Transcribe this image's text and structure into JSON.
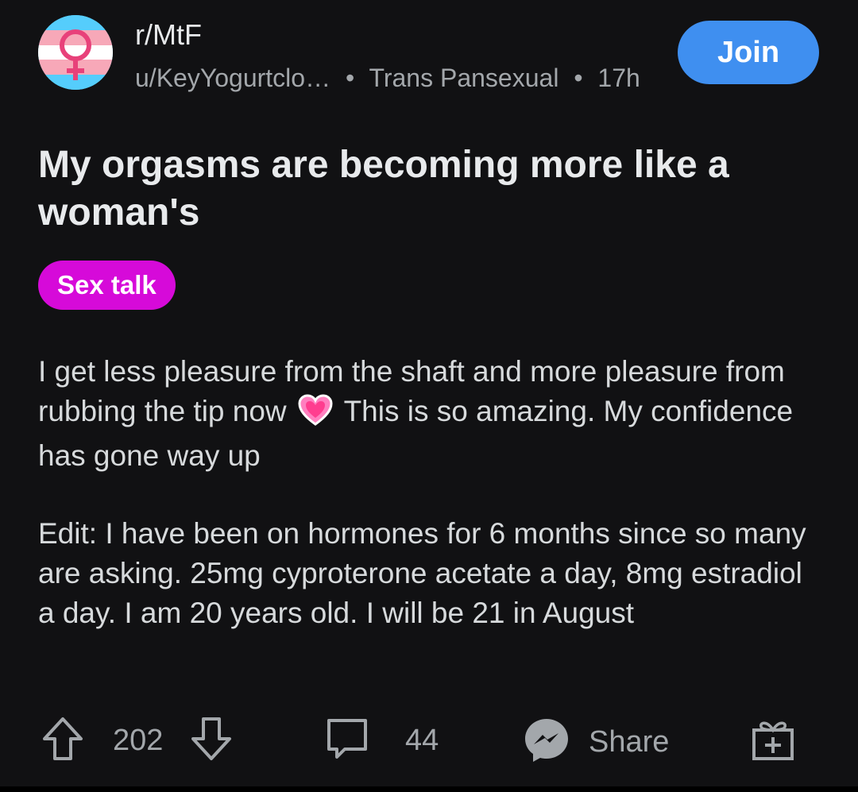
{
  "post": {
    "subreddit": "r/MtF",
    "author": "u/KeyYogurtclo…",
    "user_flair": "Trans Pansexual",
    "age": "17h",
    "join_label": "Join",
    "title": "My orgasms are becoming more like a woman's",
    "flair": "Sex talk",
    "body_p1_a": "I get less pleasure from the shaft and more pleasure from rubbing the tip now",
    "body_p1_b": "This is so amazing. My confidence has gone way up",
    "body_p2": "Edit: I have been on hormones for 6 months since so many are asking. 25mg cyproterone acetate a day, 8mg estradiol a day. I am 20 years old. I will be 21 in August"
  },
  "actions": {
    "upvotes": "202",
    "comments": "44",
    "share_label": "Share"
  },
  "icons": {
    "avatar": "trans-flag-venus-icon",
    "upvote": "upvote-arrow-icon",
    "downvote": "downvote-arrow-icon",
    "comment": "comment-bubble-icon",
    "share": "messenger-icon",
    "award": "gift-icon",
    "emoji": "heart-emoji-icon"
  },
  "colors": {
    "background": "#111113",
    "join_button": "#3f8ff0",
    "flair": "#d60ad9",
    "text": "#d7dadc",
    "muted": "#a3a7ab"
  }
}
